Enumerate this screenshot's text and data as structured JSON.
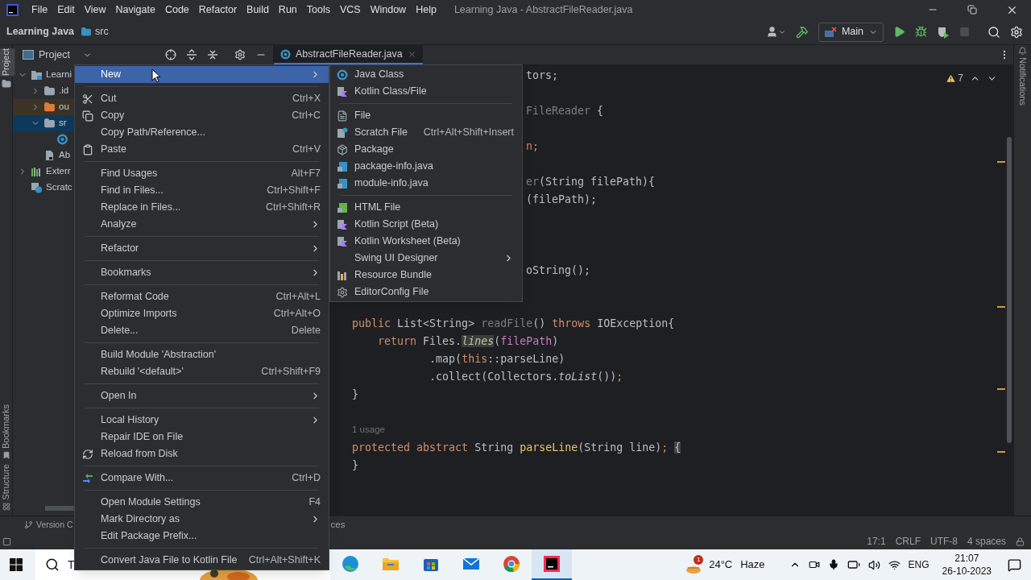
{
  "menu_bar": [
    "File",
    "Edit",
    "View",
    "Navigate",
    "Code",
    "Refactor",
    "Build",
    "Run",
    "Tools",
    "VCS",
    "Window",
    "Help"
  ],
  "window": {
    "title": "Learning Java - AbstractFileReader.java"
  },
  "breadcrumb": {
    "project": "Learning Java",
    "folder": "src"
  },
  "run_config": {
    "name": "Main"
  },
  "project_panel": {
    "title": "Project",
    "tree": [
      {
        "label": "Learni",
        "kind": "module",
        "expanded": true,
        "selected": false,
        "children": [
          {
            "label": ".id",
            "kind": "folder",
            "expanded": false,
            "selected": false
          },
          {
            "label": "ou",
            "kind": "excluded-folder",
            "expanded": false,
            "selected": false
          },
          {
            "label": "sr",
            "kind": "folder",
            "expanded": true,
            "selected": true,
            "children": [
              {
                "kind": "class",
                "selected": false
              }
            ]
          },
          {
            "label": "Ab",
            "kind": "file",
            "selected": false
          }
        ]
      },
      {
        "label": "Exterr",
        "kind": "library",
        "expanded": false,
        "selected": false
      },
      {
        "label": "Scratc",
        "kind": "scratch",
        "selected": false
      }
    ]
  },
  "editor": {
    "tab": "AbstractFileReader.java",
    "warnings": "7",
    "lines": [
      {
        "kind": "cut",
        "segments": [
          {
            "text": "tors;",
            "kind": "plain"
          }
        ]
      },
      {
        "kind": "blank"
      },
      {
        "kind": "cut",
        "segments": [
          {
            "text": "FileReader",
            "kind": "unused"
          },
          {
            "text": " {",
            "kind": "plain"
          }
        ]
      },
      {
        "kind": "blank"
      },
      {
        "kind": "cut",
        "segments": [
          {
            "text": "n",
            "kind": "error"
          },
          {
            "text": ";",
            "kind": "keyword"
          }
        ]
      },
      {
        "kind": "blank"
      },
      {
        "kind": "cut",
        "segments": [
          {
            "text": "er",
            "kind": "unused"
          },
          {
            "text": "(String filePath){",
            "kind": "plain"
          }
        ]
      },
      {
        "kind": "cut",
        "segments": [
          {
            "text": "(filePath);",
            "kind": "plain"
          }
        ]
      },
      {
        "kind": "blank"
      },
      {
        "kind": "blank"
      },
      {
        "kind": "blank"
      },
      {
        "kind": "cut",
        "segments": [
          {
            "text": "oString();",
            "kind": "plain"
          }
        ]
      },
      {
        "kind": "blank"
      },
      {
        "kind": "blank"
      },
      {
        "kind": "code",
        "segments": [
          {
            "text": "    public",
            "kind": "keyword"
          },
          {
            "text": " List<String> ",
            "kind": "plain"
          },
          {
            "text": "readFile",
            "kind": "unused"
          },
          {
            "text": "() ",
            "kind": "plain"
          },
          {
            "text": "throws",
            "kind": "keyword"
          },
          {
            "text": " IOException{",
            "kind": "plain"
          }
        ]
      },
      {
        "kind": "code",
        "segments": [
          {
            "text": "        return",
            "kind": "keyword"
          },
          {
            "text": " Files.",
            "kind": "plain"
          },
          {
            "text": "lines",
            "kind": "static-marked"
          },
          {
            "text": "(",
            "kind": "plain"
          },
          {
            "text": "filePath",
            "kind": "field"
          },
          {
            "text": ")",
            "kind": "plain"
          }
        ]
      },
      {
        "kind": "code",
        "segments": [
          {
            "text": "                .map(",
            "kind": "plain"
          },
          {
            "text": "this",
            "kind": "keyword"
          },
          {
            "text": "::parseLine)",
            "kind": "plain"
          }
        ]
      },
      {
        "kind": "code",
        "segments": [
          {
            "text": "                .collect(Collectors.",
            "kind": "plain"
          },
          {
            "text": "toList",
            "kind": "static"
          },
          {
            "text": "())",
            "kind": "plain"
          },
          {
            "text": ";",
            "kind": "keyword"
          }
        ]
      },
      {
        "kind": "code",
        "segments": [
          {
            "text": "    }",
            "kind": "plain"
          }
        ]
      },
      {
        "kind": "blank"
      },
      {
        "kind": "inlay",
        "text": "1 usage"
      },
      {
        "kind": "code",
        "segments": [
          {
            "text": "    protected abstract",
            "kind": "keyword"
          },
          {
            "text": " String ",
            "kind": "plain"
          },
          {
            "text": "parseLine",
            "kind": "method"
          },
          {
            "text": "(String line)",
            "kind": "plain"
          },
          {
            "text": "; ",
            "kind": "keyword"
          },
          {
            "text": "{",
            "kind": "brace"
          }
        ]
      },
      {
        "kind": "code",
        "segments": [
          {
            "text": "    }",
            "kind": "plain"
          }
        ]
      }
    ]
  },
  "context_menu": [
    [
      {
        "label": "New",
        "kind": "plain",
        "submenu": true,
        "selected": true
      }
    ],
    [
      {
        "label": "Cut",
        "kind": "scissors",
        "shortcut": "Ctrl+X",
        "submenu": false,
        "selected": false
      },
      {
        "label": "Copy",
        "kind": "copy",
        "shortcut": "Ctrl+C",
        "submenu": false,
        "selected": false
      },
      {
        "label": "Copy Path/Reference...",
        "kind": "plain",
        "submenu": false,
        "selected": false
      },
      {
        "label": "Paste",
        "kind": "clipboard",
        "shortcut": "Ctrl+V",
        "submenu": false,
        "selected": false
      }
    ],
    [
      {
        "label": "Find Usages",
        "kind": "plain",
        "shortcut": "Alt+F7",
        "submenu": false,
        "selected": false
      },
      {
        "label": "Find in Files...",
        "kind": "plain",
        "shortcut": "Ctrl+Shift+F",
        "submenu": false,
        "selected": false
      },
      {
        "label": "Replace in Files...",
        "kind": "plain",
        "shortcut": "Ctrl+Shift+R",
        "submenu": false,
        "selected": false
      },
      {
        "label": "Analyze",
        "kind": "plain",
        "submenu": true,
        "selected": false
      }
    ],
    [
      {
        "label": "Refactor",
        "kind": "plain",
        "submenu": true,
        "selected": false
      }
    ],
    [
      {
        "label": "Bookmarks",
        "kind": "plain",
        "submenu": true,
        "selected": false
      }
    ],
    [
      {
        "label": "Reformat Code",
        "kind": "plain",
        "shortcut": "Ctrl+Alt+L",
        "submenu": false,
        "selected": false
      },
      {
        "label": "Optimize Imports",
        "kind": "plain",
        "shortcut": "Ctrl+Alt+O",
        "submenu": false,
        "selected": false
      },
      {
        "label": "Delete...",
        "kind": "plain",
        "shortcut": "Delete",
        "submenu": false,
        "selected": false
      }
    ],
    [
      {
        "label": "Build Module 'Abstraction'",
        "kind": "plain",
        "submenu": false,
        "selected": false
      },
      {
        "label": "Rebuild '<default>'",
        "kind": "plain",
        "shortcut": "Ctrl+Shift+F9",
        "submenu": false,
        "selected": false
      }
    ],
    [
      {
        "label": "Open In",
        "kind": "plain",
        "submenu": true,
        "selected": false
      }
    ],
    [
      {
        "label": "Local History",
        "kind": "plain",
        "submenu": true,
        "selected": false
      },
      {
        "label": "Repair IDE on File",
        "kind": "plain",
        "submenu": false,
        "selected": false
      },
      {
        "label": "Reload from Disk",
        "kind": "reload",
        "submenu": false,
        "selected": false
      }
    ],
    [
      {
        "label": "Compare With...",
        "kind": "compare",
        "shortcut": "Ctrl+D",
        "submenu": false,
        "selected": false
      }
    ],
    [
      {
        "label": "Open Module Settings",
        "kind": "plain",
        "shortcut": "F4",
        "submenu": false,
        "selected": false
      },
      {
        "label": "Mark Directory as",
        "kind": "plain",
        "submenu": true,
        "selected": false
      },
      {
        "label": "Edit Package Prefix...",
        "kind": "plain",
        "submenu": false,
        "selected": false
      }
    ],
    [
      {
        "label": "Convert Java File to Kotlin File",
        "kind": "plain",
        "shortcut": "Ctrl+Alt+Shift+K",
        "submenu": false,
        "selected": false
      }
    ]
  ],
  "new_submenu": [
    [
      {
        "label": "Java Class",
        "kind": "java-class",
        "submenu": false
      },
      {
        "label": "Kotlin Class/File",
        "kind": "kotlin",
        "submenu": false
      }
    ],
    [
      {
        "label": "File",
        "kind": "file",
        "submenu": false
      },
      {
        "label": "Scratch File",
        "kind": "scratch",
        "shortcut": "Ctrl+Alt+Shift+Insert",
        "submenu": false
      },
      {
        "label": "Package",
        "kind": "package",
        "submenu": false
      },
      {
        "label": "package-info.java",
        "kind": "java-file",
        "submenu": false
      },
      {
        "label": "module-info.java",
        "kind": "java-file",
        "submenu": false
      }
    ],
    [
      {
        "label": "HTML File",
        "kind": "html",
        "submenu": false
      },
      {
        "label": "Kotlin Script (Beta)",
        "kind": "kotlin",
        "submenu": false
      },
      {
        "label": "Kotlin Worksheet (Beta)",
        "kind": "kotlin",
        "submenu": false
      },
      {
        "label": "Swing UI Designer",
        "kind": "plain",
        "submenu": true
      },
      {
        "label": "Resource Bundle",
        "kind": "bundle",
        "submenu": false
      },
      {
        "label": "EditorConfig File",
        "kind": "gear",
        "submenu": false
      }
    ]
  ],
  "side_stripes": {
    "left_top": {
      "label": "Project",
      "selected": true
    },
    "left_bottom": [
      {
        "label": "Bookmarks",
        "selected": false
      },
      {
        "label": "Structure",
        "selected": false
      }
    ],
    "right": {
      "label": "Notifications",
      "selected": false
    }
  },
  "bottom_tools": {
    "version_control": "Version C",
    "cut_tab": "ces"
  },
  "status_bar": [
    "17:1",
    "CRLF",
    "UTF-8",
    "4 spaces"
  ],
  "taskbar": {
    "search": "T",
    "apps": [
      {
        "kind": "edge",
        "selected": false
      },
      {
        "kind": "explorer",
        "selected": false
      },
      {
        "kind": "store",
        "selected": false
      },
      {
        "kind": "mail",
        "selected": false
      },
      {
        "kind": "chrome",
        "selected": false
      },
      {
        "kind": "intellij",
        "selected": true
      }
    ],
    "weather": {
      "badge": "1",
      "temperature": "24°C",
      "condition": "Haze"
    },
    "language": "ENG",
    "time": "21:07",
    "date": "26-10-2023"
  }
}
